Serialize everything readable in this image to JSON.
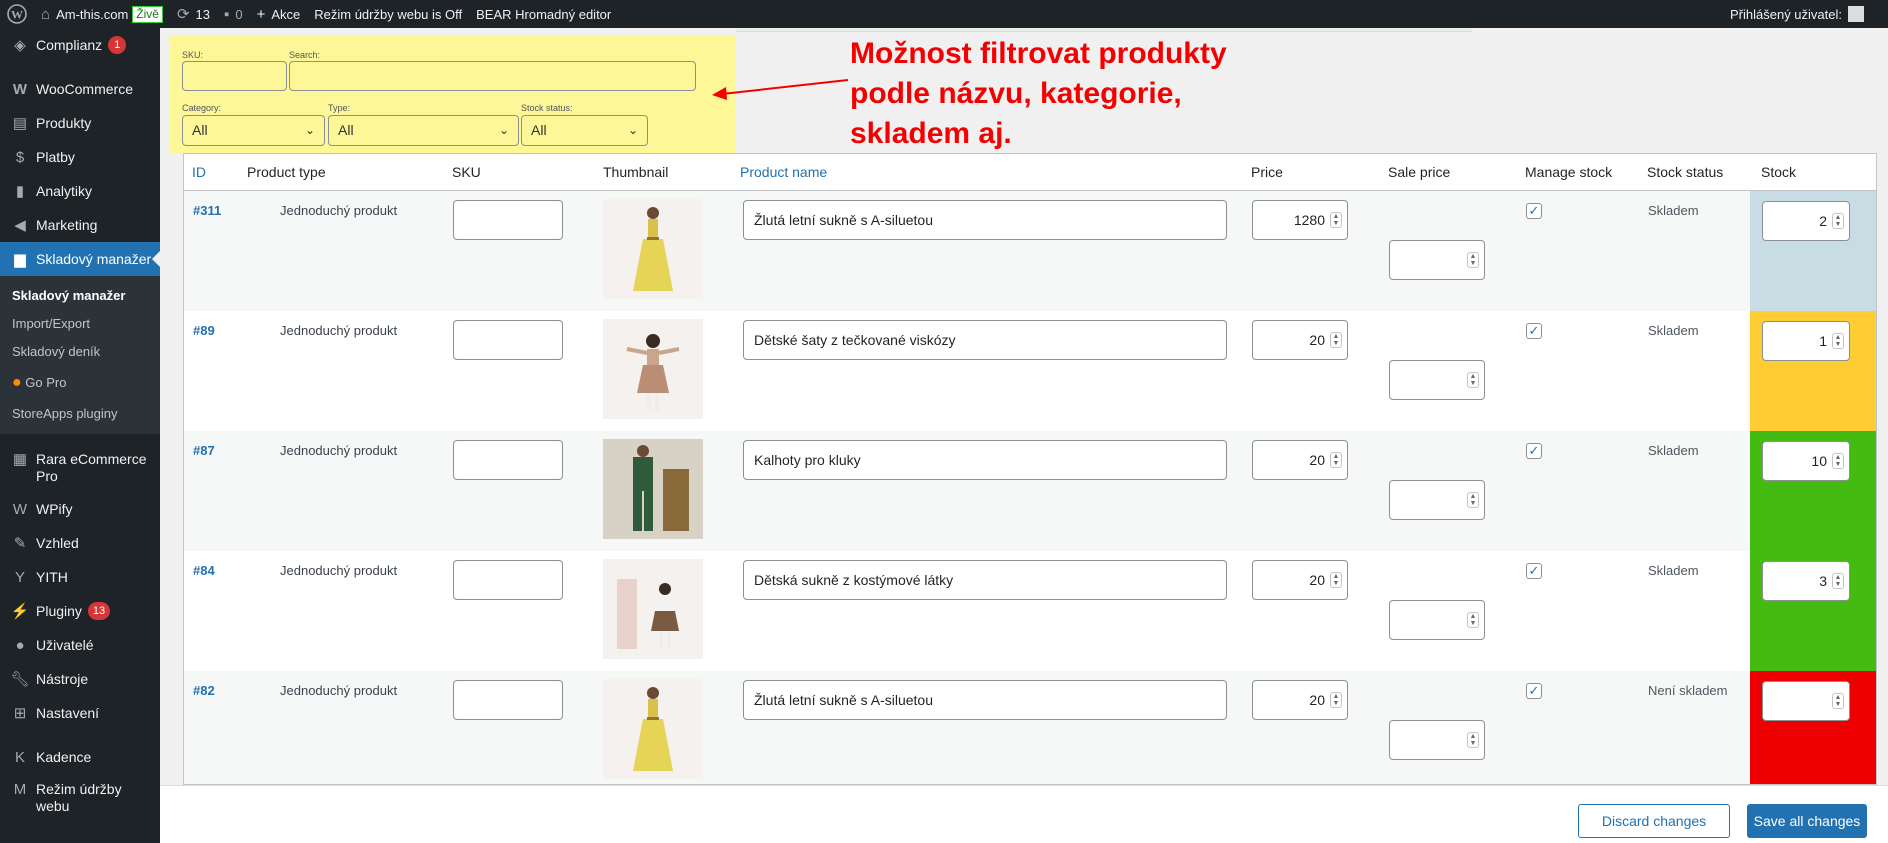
{
  "adminbar": {
    "site_name": "Am-this.com",
    "live_badge": "Živě",
    "updates_count": "13",
    "comments_count": "0",
    "new_label": "Akce",
    "maintenance_label": "Režim údržby webu is Off",
    "bear_label": "BEAR Hromadný editor",
    "user_label": "Přihlášený uživatel:"
  },
  "sidebar": {
    "items": [
      {
        "label": "Complianz",
        "icon": "shield-icon",
        "badge": "1"
      },
      {
        "label": "WooCommerce",
        "icon": "woo-icon"
      },
      {
        "label": "Produkty",
        "icon": "archive-icon"
      },
      {
        "label": "Platby",
        "icon": "money-icon"
      },
      {
        "label": "Analytiky",
        "icon": "chart-icon"
      },
      {
        "label": "Marketing",
        "icon": "megaphone-icon"
      },
      {
        "label": "Skladový manažer",
        "icon": "book-icon"
      }
    ],
    "submenu": [
      "Skladový manažer",
      "Import/Export",
      "Skladový deník",
      "Go Pro",
      "StoreApps pluginy"
    ],
    "items2": [
      {
        "label": "Rara eCommerce Pro",
        "icon": "rara-icon"
      },
      {
        "label": "WPify",
        "icon": "wpify-icon"
      },
      {
        "label": "Vzhled",
        "icon": "brush-icon"
      },
      {
        "label": "YITH",
        "icon": "yith-icon"
      },
      {
        "label": "Pluginy",
        "icon": "plugin-icon",
        "badge": "13"
      },
      {
        "label": "Uživatelé",
        "icon": "user-icon"
      },
      {
        "label": "Nástroje",
        "icon": "wrench-icon"
      },
      {
        "label": "Nastavení",
        "icon": "settings-icon"
      }
    ],
    "items3": [
      {
        "label": "Kadence",
        "icon": "kadence-icon"
      },
      {
        "label": "Režim údržby webu",
        "icon": "maintenance-icon"
      }
    ]
  },
  "filters": {
    "sku_label": "SKU:",
    "search_label": "Search:",
    "category_label": "Category:",
    "category_value": "All",
    "type_label": "Type:",
    "type_value": "All",
    "stock_label": "Stock status:",
    "stock_value": "All"
  },
  "annotation": {
    "line1": "Možnost filtrovat produkty",
    "line2": "podle názvu, kategorie,",
    "line3": "skladem aj."
  },
  "table": {
    "columns": [
      "ID",
      "Product type",
      "SKU",
      "Thumbnail",
      "Product name",
      "Price",
      "Sale price",
      "Manage stock",
      "Stock status",
      "Stock"
    ],
    "rows": [
      {
        "id": "#311",
        "type": "Jednoduchý produkt",
        "name": "Žlutá letní sukně s A-siluetou",
        "price": "1280",
        "manage": true,
        "status": "Skladem",
        "stock": "2",
        "stock_color": "#c8dde3",
        "thumb": "yellow-dress"
      },
      {
        "id": "#89",
        "type": "Jednoduchý produkt",
        "name": "Dětské šaty z tečkované viskózy",
        "price": "20",
        "manage": true,
        "status": "Skladem",
        "stock": "1",
        "stock_color": "#ffcc33",
        "thumb": "kid-dress"
      },
      {
        "id": "#87",
        "type": "Jednoduchý produkt",
        "name": "Kalhoty pro kluky",
        "price": "20",
        "manage": true,
        "status": "Skladem",
        "stock": "10",
        "stock_color": "#44bb11",
        "thumb": "boy-pants"
      },
      {
        "id": "#84",
        "type": "Jednoduchý produkt",
        "name": "Dětská sukně z kostýmové látky",
        "price": "20",
        "manage": true,
        "status": "Skladem",
        "stock": "3",
        "stock_color": "#44bb11",
        "thumb": "kid-skirt"
      },
      {
        "id": "#82",
        "type": "Jednoduchý produkt",
        "name": "Žlutá letní sukně s A-siluetou",
        "price": "20",
        "manage": true,
        "status": "Není skladem",
        "stock": "",
        "stock_color": "#ee0000",
        "thumb": "yellow-dress"
      }
    ]
  },
  "footer": {
    "discard_label": "Discard changes",
    "save_label": "Save all changes"
  }
}
